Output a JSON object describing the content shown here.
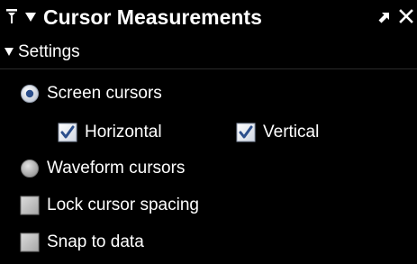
{
  "panel": {
    "title": "Cursor Measurements",
    "pin_icon": "pin-icon",
    "collapse_icon": "triangle-down-icon",
    "undock_icon": "undock-arrow-icon",
    "close_icon": "close-icon"
  },
  "settings": {
    "section_label": "Settings",
    "expanded": true,
    "cursor_mode": {
      "selected": "screen",
      "screen_label": "Screen cursors",
      "waveform_label": "Waveform cursors"
    },
    "screen_options": {
      "horizontal_label": "Horizontal",
      "horizontal_checked": true,
      "vertical_label": "Vertical",
      "vertical_checked": true
    },
    "lock_spacing_label": "Lock cursor spacing",
    "lock_spacing_checked": false,
    "snap_to_data_label": "Snap to data",
    "snap_to_data_checked": false
  },
  "colors": {
    "background": "#000000",
    "text": "#ffffff",
    "radio_selected_ring": "#d8dde6",
    "radio_selected_dot": "#2c4f8c",
    "checkbox_border": "#b8c2d4",
    "check_mark": "#2c4f8c",
    "unchecked_fill": "#b5b5b5"
  }
}
